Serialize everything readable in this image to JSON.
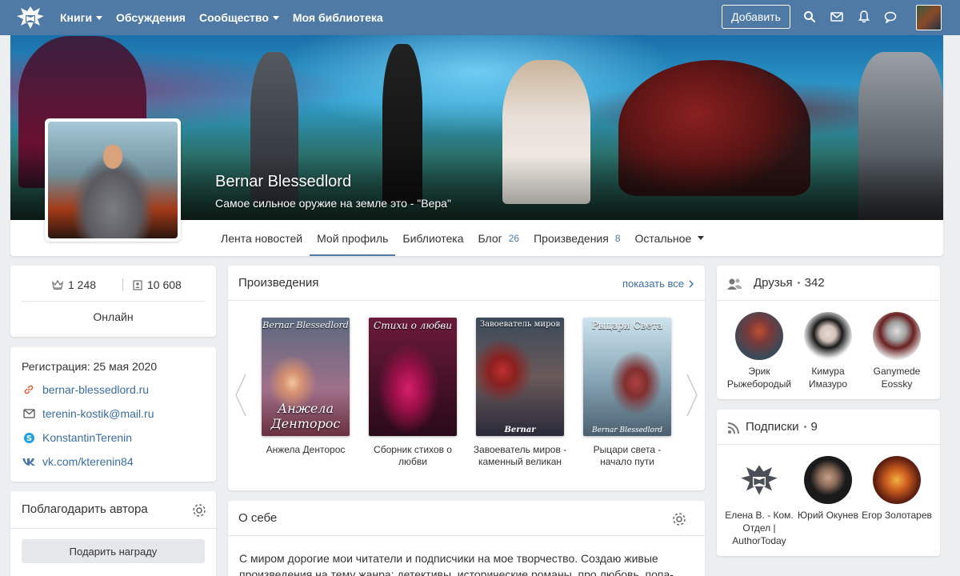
{
  "nav": {
    "links": [
      {
        "label": "Книги",
        "dropdown": true
      },
      {
        "label": "Обсуждения",
        "dropdown": false
      },
      {
        "label": "Сообщество",
        "dropdown": true
      },
      {
        "label": "Моя библиотека",
        "dropdown": false
      }
    ],
    "add_label": "Добавить"
  },
  "profile": {
    "name": "Bernar Blessedlord",
    "status": "Самое сильное оружие на земле это - \"Вера\""
  },
  "tabs": [
    {
      "label": "Лента новостей",
      "count": "",
      "active": false
    },
    {
      "label": "Мой профиль",
      "count": "",
      "active": true
    },
    {
      "label": "Библиотека",
      "count": "",
      "active": false
    },
    {
      "label": "Блог",
      "count": "26",
      "active": false
    },
    {
      "label": "Произведения",
      "count": "8",
      "active": false
    },
    {
      "label": "Остальное",
      "count": "",
      "active": false,
      "dropdown": true
    }
  ],
  "stats": {
    "rating": "1 248",
    "followers": "10 608",
    "online": "Онлайн"
  },
  "info": {
    "registration": "Регистрация: 25 мая 2020",
    "site": "bernar-blessedlord.ru",
    "email": "terenin-kostik@mail.ru",
    "skype": "KonstantinTerenin",
    "vk": "vk.com/kterenin84"
  },
  "thanks": {
    "title": "Поблагодарить автора",
    "button": "Подарить награду"
  },
  "works": {
    "title": "Произведения",
    "show_all": "показать все",
    "books": [
      {
        "title": "Анжела Денторос",
        "cover_author": "Bernar Blessedlord",
        "cover_title": "Анжела Денторос",
        "cover_foot": ""
      },
      {
        "title": "Сборник стихов о любви",
        "cover_author": "Стихи о любви",
        "cover_title": "",
        "cover_foot": ""
      },
      {
        "title": "Завоеватель миров - каменный великан",
        "cover_author": "Завоеватель миров",
        "cover_title": "",
        "cover_foot": "Bernar"
      },
      {
        "title": "Рыцари света - начало пути",
        "cover_author": "Рыцари Света",
        "cover_title": "",
        "cover_foot": "Bernar Blessedlord"
      }
    ]
  },
  "about": {
    "title": "О себе",
    "text": "С миром дорогие мои читатели и подписчики на мое творчество. Создаю живые произведения на тему жанра: детективы, исторические романы, про любовь, попа-"
  },
  "friends": {
    "title": "Друзья",
    "count": "342",
    "people": [
      {
        "name": "Эрик Рыжебородый"
      },
      {
        "name": "Кимура Имазуро"
      },
      {
        "name": "Ganymede Eossky"
      }
    ]
  },
  "subs": {
    "title": "Подписки",
    "count": "9",
    "people": [
      {
        "name": "Елена В. - Ком. Отдел | AuthorToday"
      },
      {
        "name": "Юрий Окунев"
      },
      {
        "name": "Егор Золотарев"
      }
    ]
  },
  "colors": {
    "navbar": "#4f7aa6",
    "link": "#3a6da2",
    "background": "#edeef0"
  }
}
